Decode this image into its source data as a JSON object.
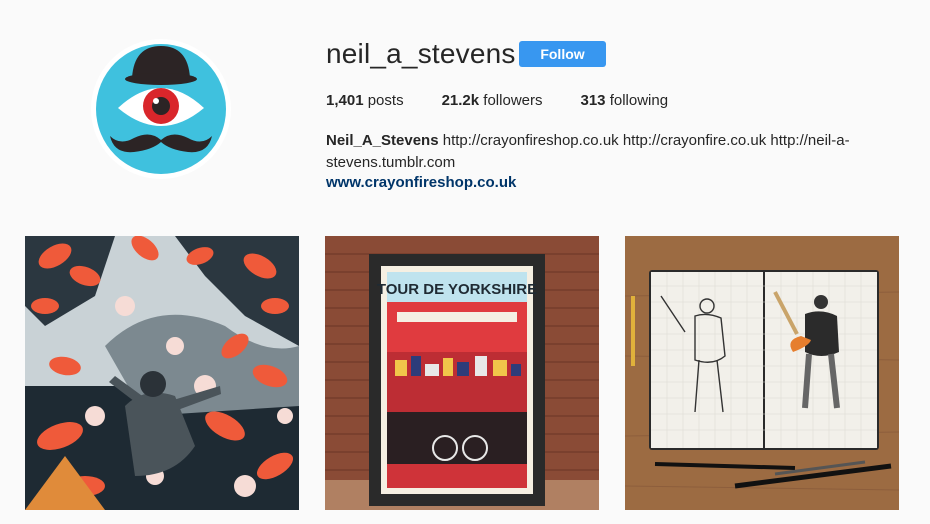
{
  "profile": {
    "username": "neil_a_stevens",
    "follow_label": "Follow",
    "avatar_icon": "bowler-hat-eye-mustache-logo"
  },
  "stats": [
    {
      "count": "1,401",
      "label": "posts"
    },
    {
      "count": "21.2k",
      "label": "followers"
    },
    {
      "count": "313",
      "label": "following"
    }
  ],
  "bio": {
    "full_name": "Neil_A_Stevens",
    "text": " http://crayonfireshop.co.uk http://crayonfire.co.uk http://neil-a-stevens.tumblr.com",
    "website": "www.crayonfireshop.co.uk"
  },
  "posts": [
    {
      "id": "post-1",
      "alt_icon": "man-among-flowers-illustration"
    },
    {
      "id": "post-2",
      "alt_icon": "tour-de-yorkshire-poster",
      "poster_title": "TOUR DE YORKSHIRE"
    },
    {
      "id": "post-3",
      "alt_icon": "sketchbook-baseball-players"
    }
  ],
  "colors": {
    "accent": "#3897f0",
    "link": "#003569",
    "avatar_bg": "#3fc1de"
  }
}
